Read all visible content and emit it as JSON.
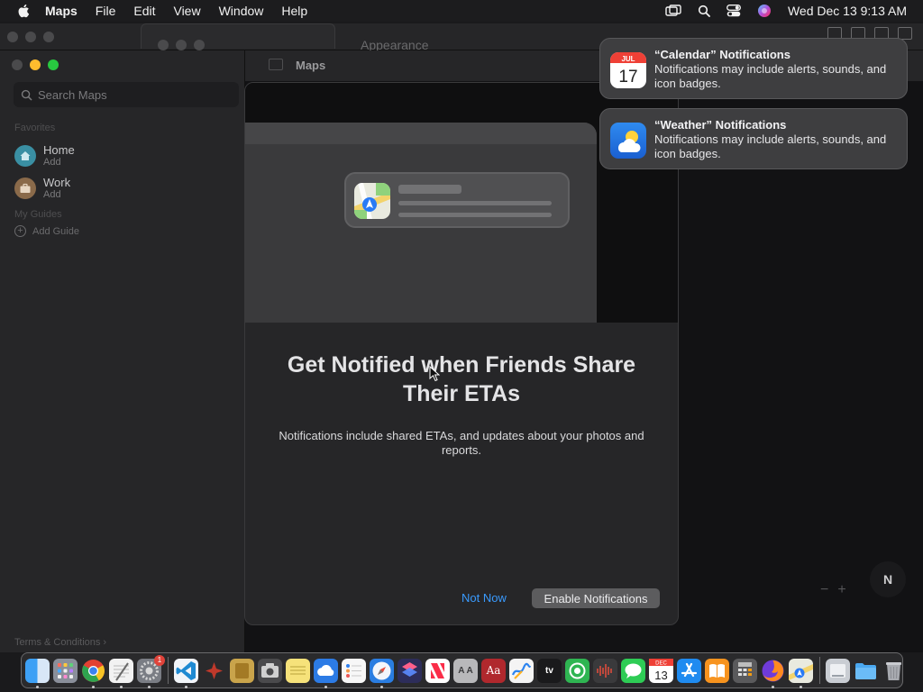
{
  "menubar": {
    "app_name": "Maps",
    "items": [
      "File",
      "Edit",
      "View",
      "Window",
      "Help"
    ],
    "clock": "Wed Dec 13  9:13 AM"
  },
  "background_window": {
    "title": "Appearance"
  },
  "maps": {
    "window_title": "Maps",
    "search_placeholder": "Search Maps",
    "favorites_label": "Favorites",
    "favorites": [
      {
        "name": "Home",
        "sub": "Add"
      },
      {
        "name": "Work",
        "sub": "Add"
      }
    ],
    "guides_label": "My Guides",
    "add_guide": "Add Guide",
    "terms": "Terms & Conditions ›",
    "compass": "N",
    "zoom_out": "−",
    "zoom_in": "+"
  },
  "sheet": {
    "title": "Get Notified when Friends Share Their ETAs",
    "body": "Notifications include shared ETAs, and updates about your photos and reports.",
    "not_now": "Not Now",
    "enable": "Enable Notifications"
  },
  "notifications": [
    {
      "app": "calendar",
      "title": "“Calendar” Notifications",
      "body": "Notifications may include alerts, sounds, and icon badges.",
      "icon_month": "JUL",
      "icon_day": "17"
    },
    {
      "app": "weather",
      "title": "“Weather” Notifications",
      "body": "Notifications may include alerts, sounds, and icon badges."
    }
  ],
  "dock": {
    "apps": [
      "finder",
      "launchpad",
      "chrome",
      "textedit",
      "system-settings",
      "vscode",
      "pixel-app",
      "notes-app",
      "screenshot",
      "stickies",
      "icloud-drive",
      "reminders",
      "safari",
      "shortcuts",
      "news",
      "font-book",
      "dictionary",
      "freeform",
      "apple-tv",
      "find-my",
      "voice-memos",
      "messages",
      "calendar",
      "app-store",
      "books",
      "calculator",
      "firefox",
      "maps",
      "downloads",
      "folder",
      "trash"
    ],
    "system_settings_badge": "1",
    "calendar_day": "13",
    "calendar_month": "DEC",
    "tv_label": "tv",
    "dictionary_label": "Aa",
    "font_book_label": "A A"
  },
  "colors": {
    "accent_link": "#3a9bff",
    "traffic_close": "#ff5f57",
    "traffic_min": "#febc2e",
    "traffic_max": "#28c840",
    "home_icon": "#3a8fa3",
    "work_icon": "#8a6a4a"
  }
}
